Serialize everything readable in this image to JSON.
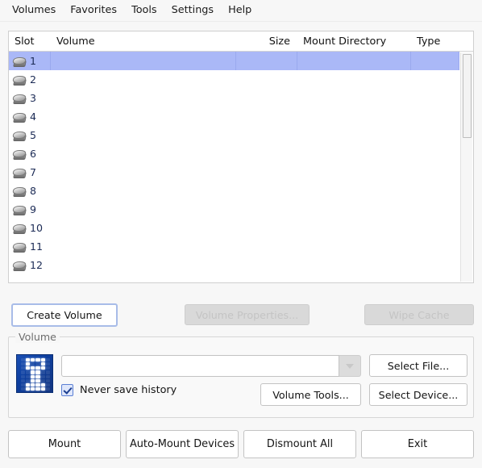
{
  "menubar": {
    "items": [
      {
        "label": "Volumes",
        "name": "menu-volumes"
      },
      {
        "label": "Favorites",
        "name": "menu-favorites"
      },
      {
        "label": "Tools",
        "name": "menu-tools"
      },
      {
        "label": "Settings",
        "name": "menu-settings"
      },
      {
        "label": "Help",
        "name": "menu-help"
      }
    ]
  },
  "volume_list": {
    "columns": {
      "slot": "Slot",
      "volume": "Volume",
      "size": "Size",
      "mount_directory": "Mount Directory",
      "type": "Type"
    },
    "rows": [
      {
        "slot": "1",
        "volume": "",
        "size": "",
        "mount_directory": "",
        "type": "",
        "selected": true
      },
      {
        "slot": "2",
        "volume": "",
        "size": "",
        "mount_directory": "",
        "type": "",
        "selected": false
      },
      {
        "slot": "3",
        "volume": "",
        "size": "",
        "mount_directory": "",
        "type": "",
        "selected": false
      },
      {
        "slot": "4",
        "volume": "",
        "size": "",
        "mount_directory": "",
        "type": "",
        "selected": false
      },
      {
        "slot": "5",
        "volume": "",
        "size": "",
        "mount_directory": "",
        "type": "",
        "selected": false
      },
      {
        "slot": "6",
        "volume": "",
        "size": "",
        "mount_directory": "",
        "type": "",
        "selected": false
      },
      {
        "slot": "7",
        "volume": "",
        "size": "",
        "mount_directory": "",
        "type": "",
        "selected": false
      },
      {
        "slot": "8",
        "volume": "",
        "size": "",
        "mount_directory": "",
        "type": "",
        "selected": false
      },
      {
        "slot": "9",
        "volume": "",
        "size": "",
        "mount_directory": "",
        "type": "",
        "selected": false
      },
      {
        "slot": "10",
        "volume": "",
        "size": "",
        "mount_directory": "",
        "type": "",
        "selected": false
      },
      {
        "slot": "11",
        "volume": "",
        "size": "",
        "mount_directory": "",
        "type": "",
        "selected": false
      },
      {
        "slot": "12",
        "volume": "",
        "size": "",
        "mount_directory": "",
        "type": "",
        "selected": false
      }
    ],
    "slot_icon": "drive-icon",
    "selection_color": "#aab8f7",
    "scrollbar": {
      "name": "vertical-scrollbar",
      "thumb_name": "scrollbar-thumb"
    }
  },
  "actions": {
    "create_volume": {
      "label": "Create Volume",
      "enabled": true,
      "focused": true
    },
    "volume_properties": {
      "label": "Volume Properties...",
      "enabled": false
    },
    "wipe_cache": {
      "label": "Wipe Cache",
      "enabled": false
    }
  },
  "volume_group": {
    "title": "Volume",
    "logo_alt": "veracrypt-logo",
    "path_input": {
      "value": "",
      "placeholder": ""
    },
    "dropdown_icon": "chevron-down-icon",
    "dropdown_enabled": false,
    "never_save_history": {
      "label": "Never save history",
      "checked": true
    },
    "select_file": {
      "label": "Select File...",
      "enabled": true
    },
    "volume_tools": {
      "label": "Volume Tools...",
      "enabled": true
    },
    "select_device": {
      "label": "Select Device...",
      "enabled": true
    }
  },
  "bottom_actions": [
    {
      "label": "Mount",
      "name": "mount-button"
    },
    {
      "label": "Auto-Mount Devices",
      "name": "auto-mount-devices-button"
    },
    {
      "label": "Dismount All",
      "name": "dismount-all-button"
    },
    {
      "label": "Exit",
      "name": "exit-button"
    }
  ]
}
